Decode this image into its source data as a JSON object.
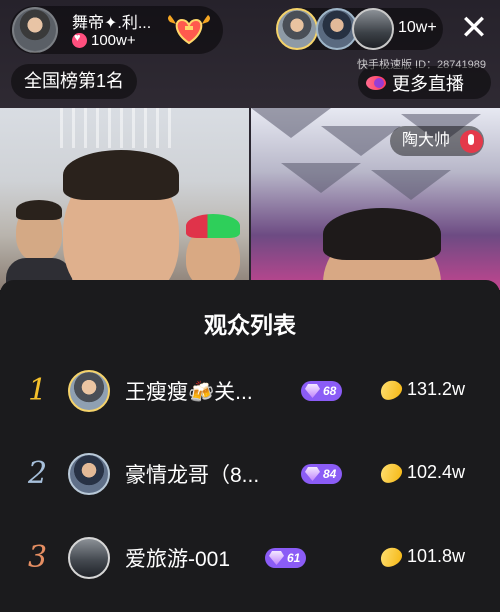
{
  "host": {
    "name": "舞帝✦.利...",
    "likes": "100w+"
  },
  "viewers": {
    "count": "10w+"
  },
  "rank_label": "全国榜第1名",
  "watermark": "快手极速版 ID：28741989",
  "more_live_label": "更多直播",
  "guest_host_name": "陶大帅",
  "colors": {
    "sheet_bg": "#1b1b1d",
    "rank1": "#f4c02c",
    "rank2": "#a7c0db",
    "rank3": "#e58e62",
    "level_badge": "#8b5cf6",
    "coin": "#f5b50e"
  },
  "audience_list": {
    "title": "观众列表",
    "rows": [
      {
        "rank": "1",
        "name": "王瘦瘦🍻关...",
        "level": "68",
        "score": "131.2w"
      },
      {
        "rank": "2",
        "name": "豪情龙哥（8...",
        "level": "84",
        "score": "102.4w"
      },
      {
        "rank": "3",
        "name": "爱旅游-001",
        "level": "61",
        "score": "101.8w"
      }
    ]
  },
  "icons": {
    "close": "close-icon",
    "heart": "heart-icon",
    "follow": "follow-heart-badge-icon",
    "more_live": "live-bubble-icon",
    "mic": "mic-icon",
    "level": "gem-icon",
    "coin": "coin-icon"
  }
}
